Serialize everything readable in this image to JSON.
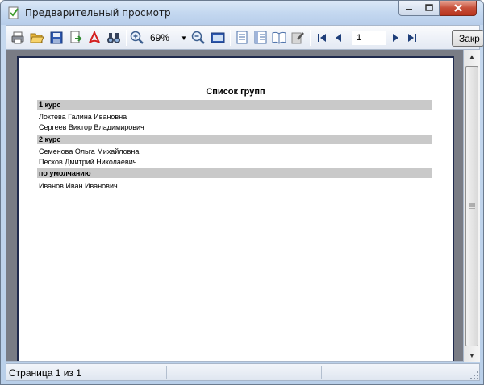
{
  "window": {
    "title": "Предварительный просмотр",
    "min_icon": "minimize-icon",
    "max_icon": "maximize-icon",
    "close_icon": "close-icon"
  },
  "toolbar": {
    "zoom": "69%",
    "page_number": "1",
    "close_label": "Закр"
  },
  "report": {
    "title": "Список групп",
    "groups": [
      {
        "name": "1 курс",
        "members": [
          "Локтева Галина Ивановна",
          "Сергеев Виктор Владимирович"
        ]
      },
      {
        "name": "2 курс",
        "members": [
          "Семенова Ольга Михайловна",
          "Песков Дмитрий Николаевич"
        ]
      },
      {
        "name": "по умолчанию",
        "members": [
          "Иванов Иван Иванович"
        ]
      }
    ]
  },
  "status": {
    "page_info": "Страница 1 из 1"
  },
  "colors": {
    "preview_bg": "#797c85",
    "group_header_bg": "#c9c9c9",
    "page_border": "#1f2a4d",
    "close_red": "#c7503a"
  }
}
